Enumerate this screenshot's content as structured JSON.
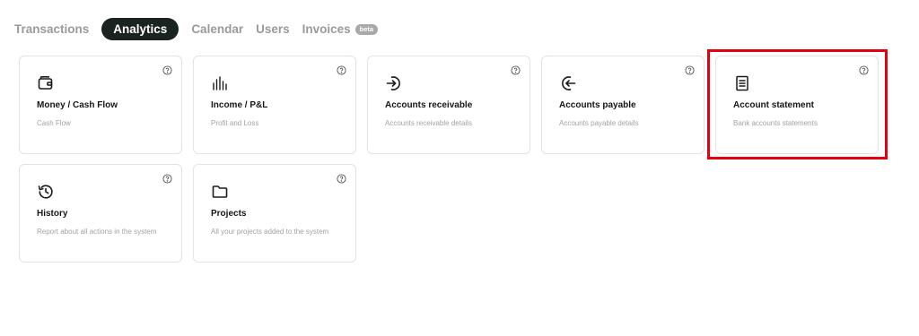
{
  "tabs": [
    {
      "label": "Transactions"
    },
    {
      "label": "Analytics"
    },
    {
      "label": "Calendar"
    },
    {
      "label": "Users"
    },
    {
      "label": "Invoices",
      "badge": "beta"
    }
  ],
  "active_tab": "Analytics",
  "cards": [
    {
      "title": "Money / Cash Flow",
      "desc": "Cash Flow",
      "icon": "wallet-icon"
    },
    {
      "title": "Income / P&L",
      "desc": "Profit and Loss",
      "icon": "bar-chart-icon"
    },
    {
      "title": "Accounts receivable",
      "desc": "Accounts receivable details",
      "icon": "arrow-in-circle-icon"
    },
    {
      "title": "Accounts payable",
      "desc": "Accounts payable details",
      "icon": "arrow-out-circle-icon"
    },
    {
      "title": "Account statement",
      "desc": "Bank accounts statements",
      "icon": "document-icon"
    },
    {
      "title": "History",
      "desc": "Report about all actions in the system",
      "icon": "history-icon"
    },
    {
      "title": "Projects",
      "desc": "All your projects added to the system",
      "icon": "folder-icon"
    }
  ],
  "colors": {
    "active_tab_bg": "#1b2320",
    "highlight": "#e5000f",
    "muted_text": "#a3a3a3"
  }
}
